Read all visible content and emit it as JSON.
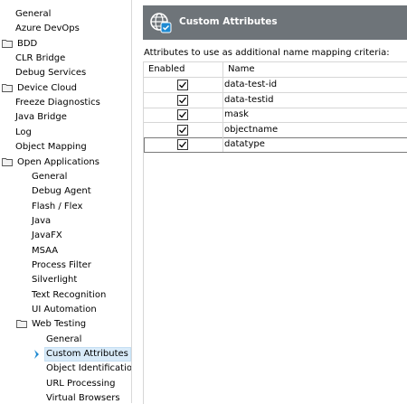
{
  "tree": {
    "items": [
      {
        "label": "General",
        "folder": false
      },
      {
        "label": "Azure DevOps",
        "folder": false
      },
      {
        "label": "BDD",
        "folder": true
      },
      {
        "label": "CLR Bridge",
        "folder": false
      },
      {
        "label": "Debug Services",
        "folder": false
      },
      {
        "label": "Device Cloud",
        "folder": true
      },
      {
        "label": "Freeze Diagnostics",
        "folder": false
      },
      {
        "label": "Java Bridge",
        "folder": false
      },
      {
        "label": "Log",
        "folder": false
      },
      {
        "label": "Object Mapping",
        "folder": false
      },
      {
        "label": "Open Applications",
        "folder": true
      },
      {
        "label": "General",
        "folder": false
      },
      {
        "label": "Debug Agent",
        "folder": false
      },
      {
        "label": "Flash / Flex",
        "folder": false
      },
      {
        "label": "Java",
        "folder": false
      },
      {
        "label": "JavaFX",
        "folder": false
      },
      {
        "label": "MSAA",
        "folder": false
      },
      {
        "label": "Process Filter",
        "folder": false
      },
      {
        "label": "Silverlight",
        "folder": false
      },
      {
        "label": "Text Recognition",
        "folder": false
      },
      {
        "label": "UI Automation",
        "folder": false
      },
      {
        "label": "Web Testing",
        "folder": true
      },
      {
        "label": "General",
        "folder": false
      },
      {
        "label": "Custom Attributes",
        "folder": false,
        "selected": true
      },
      {
        "label": "Object Identification",
        "folder": false
      },
      {
        "label": "URL Processing",
        "folder": false
      },
      {
        "label": "Virtual Browsers",
        "folder": false
      }
    ]
  },
  "header": {
    "title": "Custom Attributes",
    "icon": "globe-settings-icon"
  },
  "caption": "Attributes to use as additional name mapping criteria:",
  "grid": {
    "columns": [
      "Enabled",
      "Name"
    ],
    "rows": [
      {
        "enabled": true,
        "name": "data-test-id"
      },
      {
        "enabled": true,
        "name": "data-testid"
      },
      {
        "enabled": true,
        "name": "mask"
      },
      {
        "enabled": true,
        "name": "objectname"
      },
      {
        "enabled": true,
        "name": "datatype",
        "selected": true
      }
    ]
  },
  "colors": {
    "header_bg": "#6e7479",
    "selection": "#d9ebf9",
    "accent": "#1f8ad2"
  }
}
